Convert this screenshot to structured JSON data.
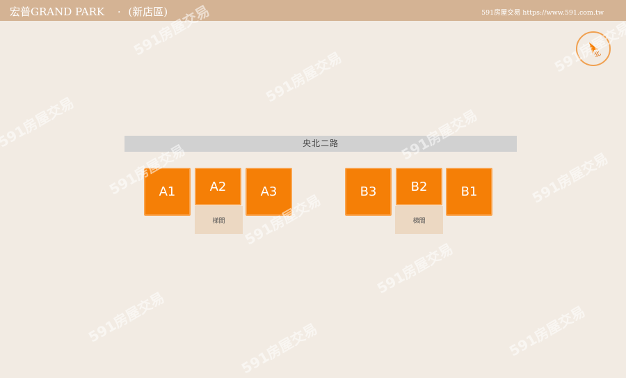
{
  "header": {
    "project_name": "宏普GRAND PARK",
    "separator": "·",
    "district": "(新店區)",
    "site_credit": "591房屋交易 https://www.591.com.tw"
  },
  "compass": {
    "label": "北"
  },
  "road": {
    "name": "央北二路"
  },
  "buildings": {
    "a1": "A1",
    "a2": "A2",
    "a3": "A3",
    "b3": "B3",
    "b2": "B2",
    "b1": "B1",
    "stair_a": "梯間",
    "stair_b": "梯間"
  },
  "watermark": {
    "text": "591房屋交易"
  },
  "colors": {
    "unit": "#f57f06",
    "header": "#d4b394",
    "road": "#d1d1d1",
    "stair": "#ecd8c2"
  }
}
